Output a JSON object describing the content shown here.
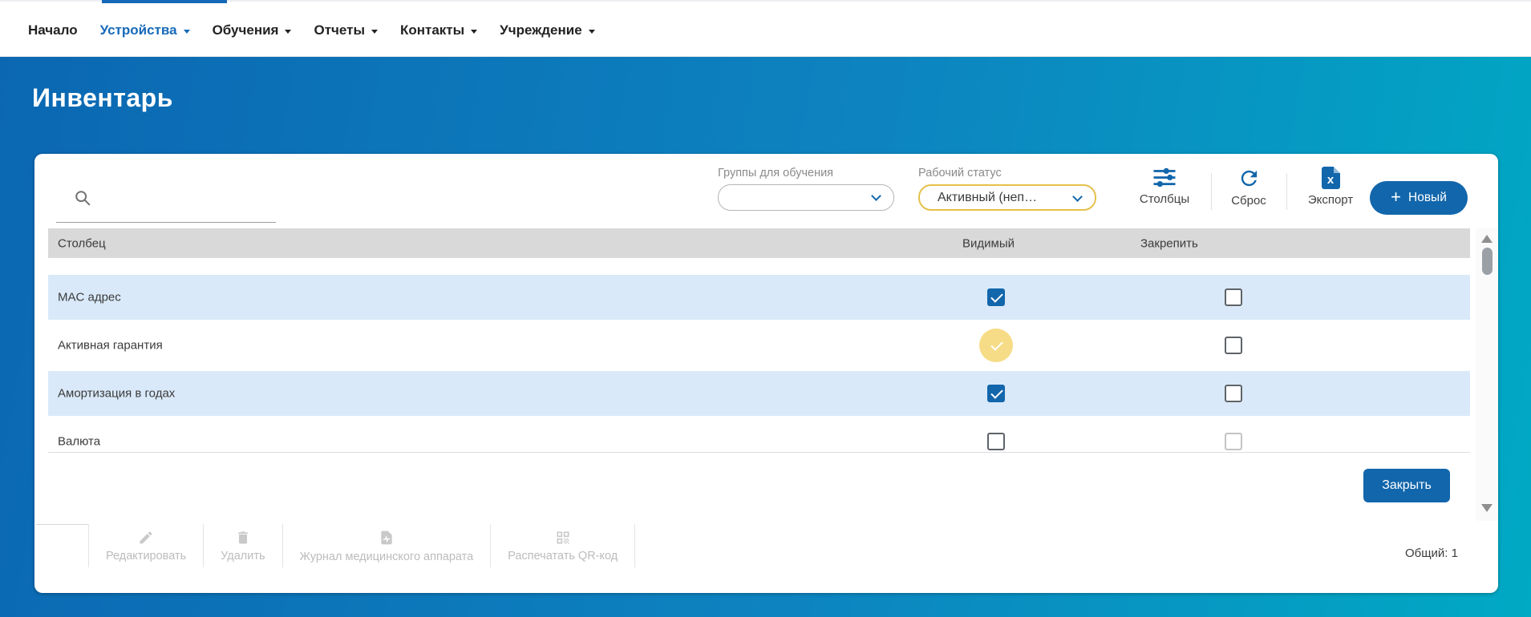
{
  "colors": {
    "accent": "#1266ab",
    "nav_active": "#1669b8",
    "gradient_left": "#0b67b2",
    "gradient_right": "#00a9c4",
    "row_blue": "#d9e9f9",
    "header_gray": "#d9d9d9",
    "highlight_yellow": "#f6dc86",
    "highlight_check_green": "#6b9e68",
    "warning_border": "#e4c14b"
  },
  "nav": {
    "items": [
      {
        "label": "Начало",
        "active": false
      },
      {
        "label": "Устройства",
        "active": true
      },
      {
        "label": "Обучения",
        "active": false
      },
      {
        "label": "Отчеты",
        "active": false
      },
      {
        "label": "Контакты",
        "active": false
      },
      {
        "label": "Учреждение",
        "active": false
      }
    ]
  },
  "page": {
    "title": "Инвентарь"
  },
  "toolbar": {
    "search": {
      "value": "",
      "placeholder": ""
    },
    "filters": [
      {
        "label": "Группы для обучения",
        "value": ""
      },
      {
        "label": "Рабочий статус",
        "value": "Активный (неп…"
      }
    ],
    "buttons": {
      "columns": "Столбцы",
      "reset": "Сброс",
      "export": "Экспорт",
      "new": "Новый",
      "new_plus": "+"
    }
  },
  "columns_panel": {
    "headers": [
      "Столбец",
      "Видимый",
      "Закрепить"
    ],
    "rows": [
      {
        "name": "MAC адрес",
        "visible": true,
        "pinned": false,
        "highlighted": false
      },
      {
        "name": "Активная гарантия",
        "visible": true,
        "pinned": false,
        "highlighted": true
      },
      {
        "name": "Амортизация в годах",
        "visible": true,
        "pinned": false,
        "highlighted": false
      },
      {
        "name": "Валюта",
        "visible": false,
        "pinned": false,
        "highlighted": false
      }
    ],
    "close_label": "Закрыть"
  },
  "footer": {
    "actions": [
      "Редактировать",
      "Удалить",
      "Журнал медицинского аппарата",
      "Распечатать QR-код"
    ],
    "total_label": "Общий: 1"
  },
  "icons": {
    "excel_letter": "x"
  }
}
